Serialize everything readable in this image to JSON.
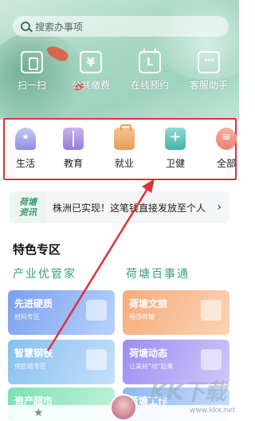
{
  "search": {
    "placeholder": "搜索办事项"
  },
  "quick_actions": [
    {
      "label": "扫一扫",
      "icon": "scan-icon"
    },
    {
      "label": "公共缴费",
      "icon": "yen-wallet-icon"
    },
    {
      "label": "在线预约",
      "icon": "calendar-icon"
    },
    {
      "label": "客服助手",
      "icon": "chat-bubble-icon"
    }
  ],
  "categories": [
    {
      "label": "生活",
      "icon": "home-star-icon"
    },
    {
      "label": "教育",
      "icon": "book-icon"
    },
    {
      "label": "就业",
      "icon": "briefcase-icon"
    },
    {
      "label": "卫健",
      "icon": "medical-kit-icon"
    },
    {
      "label": "全部",
      "icon": "menu-icon"
    }
  ],
  "news": {
    "tag_line1": "荷塘",
    "tag_line2": "资讯",
    "text": "株洲已实现！这笔钱直接发放至个人",
    "chevron": "›"
  },
  "section": {
    "title": "特色专区",
    "left_subtitle": "产业优管家",
    "right_subtitle": "荷塘百事通"
  },
  "cards": [
    {
      "title": "先进硬质",
      "sub": "材料专区"
    },
    {
      "title": "荷塘文旅",
      "sub": "畅游荷塘"
    },
    {
      "title": "智慧钢铁",
      "sub": "供应链专区"
    },
    {
      "title": "荷塘动态",
      "sub": "让美好\"动\"起来"
    },
    {
      "title": "资产超市",
      "sub": ""
    },
    {
      "title": "荷塘工作",
      "sub": ""
    }
  ],
  "watermark": {
    "big": "KK下载",
    "small": "www.kkx.net"
  },
  "colors": {
    "highlight_border": "#e0313a",
    "accent_green": "#3aa07a"
  }
}
